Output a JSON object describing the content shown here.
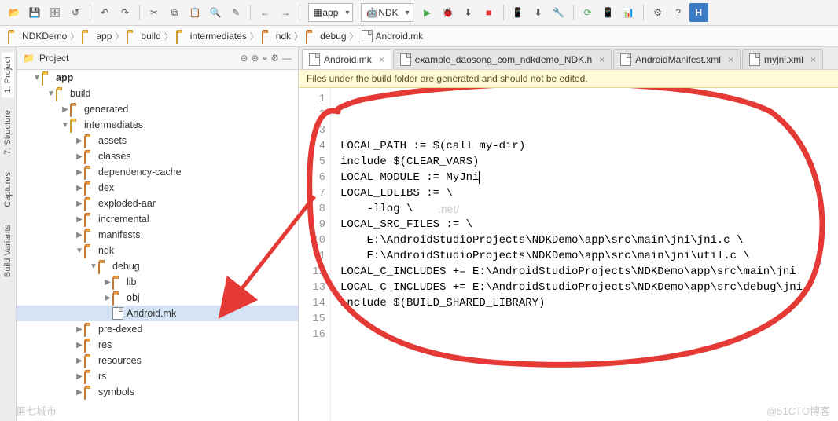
{
  "toolbar": {
    "configs": [
      "app",
      "NDK"
    ]
  },
  "breadcrumbs": [
    {
      "icon": "folder-yellow",
      "label": "NDKDemo"
    },
    {
      "icon": "folder-yellow",
      "label": "app"
    },
    {
      "icon": "folder-yellow",
      "label": "build"
    },
    {
      "icon": "folder-yellow",
      "label": "intermediates"
    },
    {
      "icon": "folder-orange",
      "label": "ndk"
    },
    {
      "icon": "folder-orange",
      "label": "debug"
    },
    {
      "icon": "file",
      "label": "Android.mk"
    }
  ],
  "left_tabs": [
    "1: Project",
    "7: Structure",
    "Captures",
    "Build Variants"
  ],
  "sidebar": {
    "title": "Project",
    "tree": [
      {
        "depth": 0,
        "exp": true,
        "icon": "folder-yellow",
        "label": "app",
        "bold": true
      },
      {
        "depth": 1,
        "exp": true,
        "icon": "folder-yellow",
        "label": "build"
      },
      {
        "depth": 2,
        "exp": false,
        "icon": "folder-orange",
        "label": "generated"
      },
      {
        "depth": 2,
        "exp": true,
        "icon": "folder-yellow",
        "label": "intermediates"
      },
      {
        "depth": 3,
        "exp": false,
        "icon": "folder-orange",
        "label": "assets"
      },
      {
        "depth": 3,
        "exp": false,
        "icon": "folder-orange",
        "label": "classes"
      },
      {
        "depth": 3,
        "exp": false,
        "icon": "folder-orange",
        "label": "dependency-cache"
      },
      {
        "depth": 3,
        "exp": false,
        "icon": "folder-orange",
        "label": "dex"
      },
      {
        "depth": 3,
        "exp": false,
        "icon": "folder-orange",
        "label": "exploded-aar"
      },
      {
        "depth": 3,
        "exp": false,
        "icon": "folder-orange",
        "label": "incremental"
      },
      {
        "depth": 3,
        "exp": false,
        "icon": "folder-orange",
        "label": "manifests"
      },
      {
        "depth": 3,
        "exp": true,
        "icon": "folder-orange",
        "label": "ndk"
      },
      {
        "depth": 4,
        "exp": true,
        "icon": "folder-orange",
        "label": "debug"
      },
      {
        "depth": 5,
        "exp": false,
        "icon": "folder-orange",
        "label": "lib"
      },
      {
        "depth": 5,
        "exp": false,
        "icon": "folder-orange",
        "label": "obj"
      },
      {
        "depth": 5,
        "exp": null,
        "icon": "file",
        "label": "Android.mk",
        "sel": true
      },
      {
        "depth": 3,
        "exp": false,
        "icon": "folder-orange",
        "label": "pre-dexed"
      },
      {
        "depth": 3,
        "exp": false,
        "icon": "folder-orange",
        "label": "res"
      },
      {
        "depth": 3,
        "exp": false,
        "icon": "folder-orange",
        "label": "resources"
      },
      {
        "depth": 3,
        "exp": false,
        "icon": "folder-orange",
        "label": "rs"
      },
      {
        "depth": 3,
        "exp": false,
        "icon": "folder-orange",
        "label": "symbols"
      }
    ]
  },
  "editor": {
    "tabs": [
      {
        "label": "Android.mk",
        "active": true,
        "icon": "file"
      },
      {
        "label": "example_daosong_com_ndkdemo_NDK.h",
        "active": false,
        "icon": "file"
      },
      {
        "label": "AndroidManifest.xml",
        "active": false,
        "icon": "file"
      },
      {
        "label": "myjni.xml",
        "active": false,
        "icon": "file"
      }
    ],
    "warning": "Files under the build folder are generated and should not be edited.",
    "code_watermark": ".net/",
    "lines": [
      "LOCAL_PATH := $(call my-dir)",
      "include $(CLEAR_VARS)",
      "",
      "LOCAL_MODULE := MyJni",
      "LOCAL_LDLIBS := \\",
      "    -llog \\",
      "",
      "LOCAL_SRC_FILES := \\",
      "    E:\\AndroidStudioProjects\\NDKDemo\\app\\src\\main\\jni\\jni.c \\",
      "    E:\\AndroidStudioProjects\\NDKDemo\\app\\src\\main\\jni\\util.c \\",
      "",
      "LOCAL_C_INCLUDES += E:\\AndroidStudioProjects\\NDKDemo\\app\\src\\main\\jni",
      "LOCAL_C_INCLUDES += E:\\AndroidStudioProjects\\NDKDemo\\app\\src\\debug\\jni",
      "",
      "include $(BUILD_SHARED_LIBRARY)",
      ""
    ]
  },
  "watermarks": {
    "bottom_left": "第七城市",
    "bottom_right": "@51CTO博客"
  }
}
